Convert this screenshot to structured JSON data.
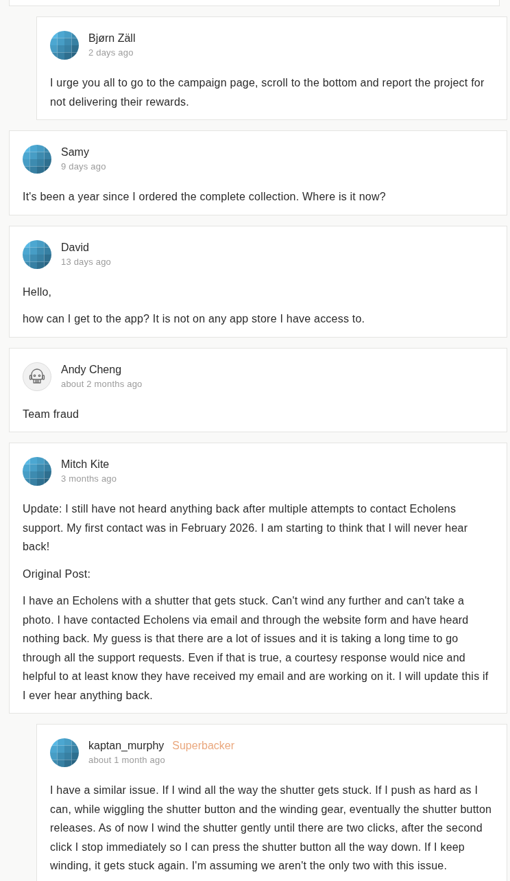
{
  "comments": [
    {
      "author": "Bjørn Zäll",
      "time": "2 days ago",
      "reply": true,
      "avatar": {
        "kind": "pattern"
      },
      "paragraphs": [
        "I urge you all to go to the campaign page, scroll to the bottom and report the project for not delivering their rewards."
      ]
    },
    {
      "author": "Samy",
      "time": "9 days ago",
      "reply": false,
      "avatar": {
        "kind": "pattern"
      },
      "paragraphs": [
        "It's been a year since I ordered the complete collection. Where is it now?"
      ]
    },
    {
      "author": "David",
      "time": "13 days ago",
      "reply": false,
      "avatar": {
        "kind": "pattern"
      },
      "paragraphs": [
        "Hello,",
        "how can I get to the app? It is not on any app store I have access to."
      ]
    },
    {
      "author": "Andy Cheng",
      "time": "about 2 months ago",
      "reply": false,
      "avatar": {
        "kind": "robot"
      },
      "paragraphs": [
        "Team fraud"
      ]
    },
    {
      "author": "Mitch Kite",
      "time": "3 months ago",
      "reply": false,
      "avatar": {
        "kind": "pattern"
      },
      "paragraphs": [
        "Update: I still have not heard anything back after multiple attempts to contact Echolens support. My first contact was in February 2026. I am starting to think that I will never hear back!",
        "Original Post:",
        "I have an Echolens with a shutter that gets stuck. Can't wind any further and can't take a photo. I have contacted Echolens via email and through the website form and have heard nothing back. My guess is that there are a lot of issues and it is taking a long time to go through all the support requests. Even if that is true, a courtesy response would nice and helpful to at least know they have received my email and are working on it. I will update this if I ever hear anything back."
      ]
    },
    {
      "author": "kaptan_murphy",
      "badge": "Superbacker",
      "time": "about 1 month ago",
      "reply": true,
      "avatar": {
        "kind": "pattern"
      },
      "paragraphs": [
        "I have a similar issue. If I wind all the way the shutter gets stuck. If I push as hard as I can, while wiggling the shutter button and the winding gear, eventually the shutter button releases. As of now I wind the shutter gently until there are two clicks, after the second click I stop immediately so I can press the shutter button all the way down. If I keep winding, it gets stuck again. I'm assuming we aren't the only two with this issue."
      ]
    }
  ]
}
